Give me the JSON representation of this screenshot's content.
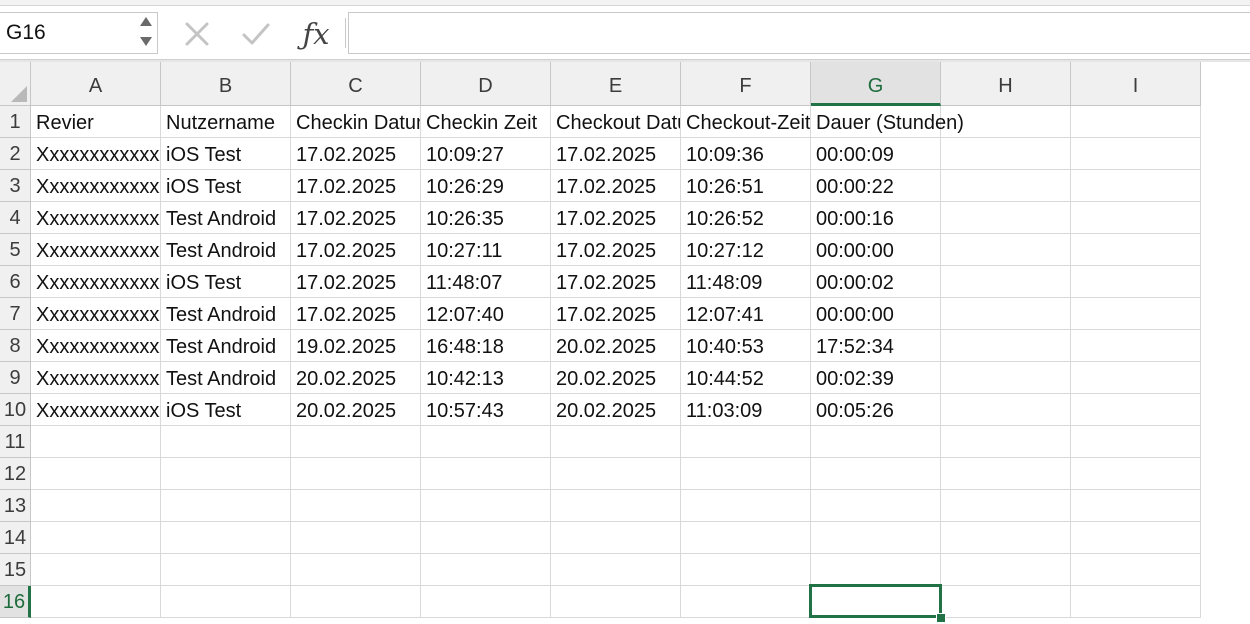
{
  "name_box": {
    "value": "G16"
  },
  "formula_bar": {
    "value": ""
  },
  "columns": [
    "A",
    "B",
    "C",
    "D",
    "E",
    "F",
    "G",
    "H",
    "I"
  ],
  "active_column": "G",
  "active_row": 16,
  "selected_cell": "G16",
  "rows": [
    {
      "num": "1",
      "cells": [
        "Revier",
        "Nutzername",
        "Checkin Datum",
        "Checkin Zeit",
        "Checkout Datum",
        "Checkout-Zeit",
        "Dauer (Stunden)",
        "",
        ""
      ]
    },
    {
      "num": "2",
      "cells": [
        "Xxxxxxxxxxxxxx",
        "iOS  Test",
        "17.02.2025",
        "10:09:27",
        "17.02.2025",
        "10:09:36",
        "00:00:09",
        "",
        ""
      ]
    },
    {
      "num": "3",
      "cells": [
        "Xxxxxxxxxxxxxx",
        "iOS  Test",
        "17.02.2025",
        "10:26:29",
        "17.02.2025",
        "10:26:51",
        "00:00:22",
        "",
        ""
      ]
    },
    {
      "num": "4",
      "cells": [
        "Xxxxxxxxxxxxxx",
        "Test Android",
        "17.02.2025",
        "10:26:35",
        "17.02.2025",
        "10:26:52",
        "00:00:16",
        "",
        ""
      ]
    },
    {
      "num": "5",
      "cells": [
        "Xxxxxxxxxxxxxx",
        "Test Android",
        "17.02.2025",
        "10:27:11",
        "17.02.2025",
        "10:27:12",
        "00:00:00",
        "",
        ""
      ]
    },
    {
      "num": "6",
      "cells": [
        "Xxxxxxxxxxxxxx",
        "iOS  Test",
        "17.02.2025",
        "11:48:07",
        "17.02.2025",
        "11:48:09",
        "00:00:02",
        "",
        ""
      ]
    },
    {
      "num": "7",
      "cells": [
        "Xxxxxxxxxxxxxx",
        "Test Android",
        "17.02.2025",
        "12:07:40",
        "17.02.2025",
        "12:07:41",
        "00:00:00",
        "",
        ""
      ]
    },
    {
      "num": "8",
      "cells": [
        "Xxxxxxxxxxxxxx",
        "Test Android",
        "19.02.2025",
        "16:48:18",
        "20.02.2025",
        "10:40:53",
        "17:52:34",
        "",
        ""
      ]
    },
    {
      "num": "9",
      "cells": [
        "Xxxxxxxxxxxxxx",
        "Test Android",
        "20.02.2025",
        "10:42:13",
        "20.02.2025",
        "10:44:52",
        "00:02:39",
        "",
        ""
      ]
    },
    {
      "num": "10",
      "cells": [
        "Xxxxxxxxxxxxxx",
        "iOS  Test",
        "20.02.2025",
        "10:57:43",
        "20.02.2025",
        "11:03:09",
        "00:05:26",
        "",
        ""
      ]
    },
    {
      "num": "11",
      "cells": [
        "",
        "",
        "",
        "",
        "",
        "",
        "",
        "",
        ""
      ]
    },
    {
      "num": "12",
      "cells": [
        "",
        "",
        "",
        "",
        "",
        "",
        "",
        "",
        ""
      ]
    },
    {
      "num": "13",
      "cells": [
        "",
        "",
        "",
        "",
        "",
        "",
        "",
        "",
        ""
      ]
    },
    {
      "num": "14",
      "cells": [
        "",
        "",
        "",
        "",
        "",
        "",
        "",
        "",
        ""
      ]
    },
    {
      "num": "15",
      "cells": [
        "",
        "",
        "",
        "",
        "",
        "",
        "",
        "",
        ""
      ]
    },
    {
      "num": "16",
      "cells": [
        "",
        "",
        "",
        "",
        "",
        "",
        "",
        "",
        ""
      ]
    }
  ],
  "colors": {
    "accent": "#217346",
    "header_bg": "#f0f0f0",
    "gridline": "#d9d9d9"
  },
  "icons": {
    "cancel": "close-icon",
    "enter": "check-icon",
    "function": "fx-icon"
  }
}
